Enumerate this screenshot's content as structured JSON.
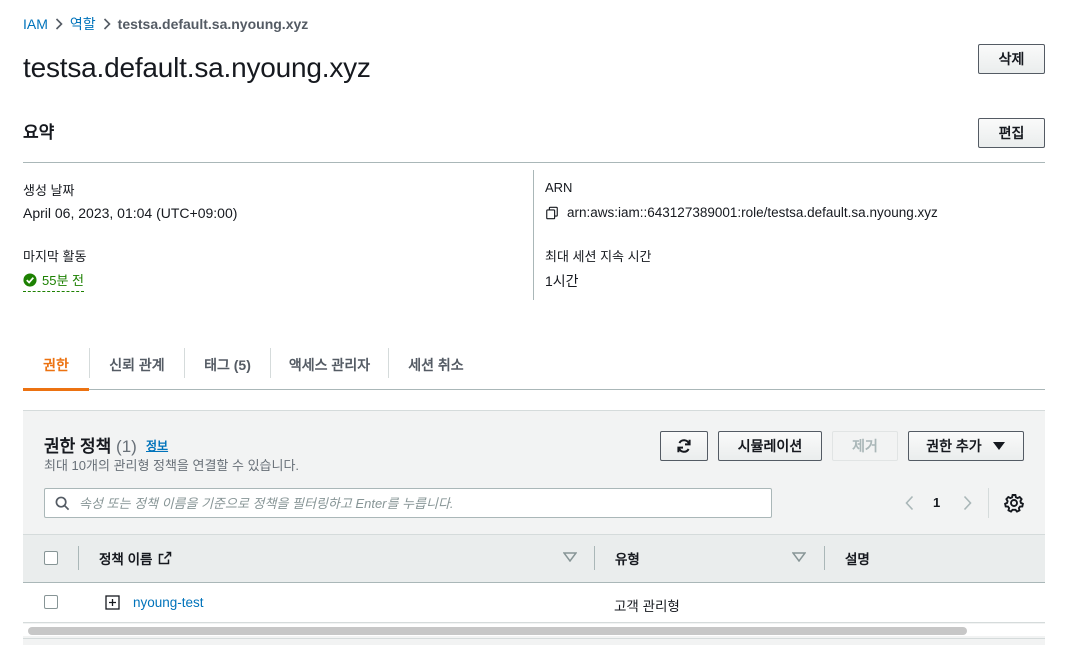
{
  "breadcrumb": {
    "items": [
      "IAM",
      "역할"
    ],
    "current": "testsa.default.sa.nyoung.xyz"
  },
  "page": {
    "title": "testsa.default.sa.nyoung.xyz",
    "delete_label": "삭제"
  },
  "summary": {
    "title": "요약",
    "edit_label": "편집",
    "created_label": "생성 날짜",
    "created_value": "April 06, 2023, 01:04 (UTC+09:00)",
    "last_activity_label": "마지막 활동",
    "last_activity_value": "55분 전",
    "arn_label": "ARN",
    "arn_value": "arn:aws:iam::643127389001:role/testsa.default.sa.nyoung.xyz",
    "max_session_label": "최대 세션 지속 시간",
    "max_session_value": "1시간"
  },
  "tabs": [
    {
      "label": "권한",
      "active": true
    },
    {
      "label": "신뢰 관계",
      "active": false
    },
    {
      "label": "태그 (5)",
      "active": false
    },
    {
      "label": "액세스 관리자",
      "active": false
    },
    {
      "label": "세션 취소",
      "active": false
    }
  ],
  "policies": {
    "title": "권한 정책",
    "count": "(1)",
    "info_label": "정보",
    "description": "최대 10개의 관리형 정책을 연결할 수 있습니다.",
    "simulate_label": "시뮬레이션",
    "remove_label": "제거",
    "add_label": "권한 추가",
    "search_placeholder": "속성 또는 정책 이름을 기준으로 정책을 필터링하고 Enter를 누릅니다.",
    "page_number": "1",
    "columns": [
      "정책 이름",
      "유형",
      "설명"
    ],
    "rows": [
      {
        "name": "nyoung-test",
        "type": "고객 관리형",
        "description": ""
      }
    ]
  },
  "colors": {
    "link": "#0073bb",
    "active_tab": "#ec7211",
    "success": "#1d8102"
  }
}
